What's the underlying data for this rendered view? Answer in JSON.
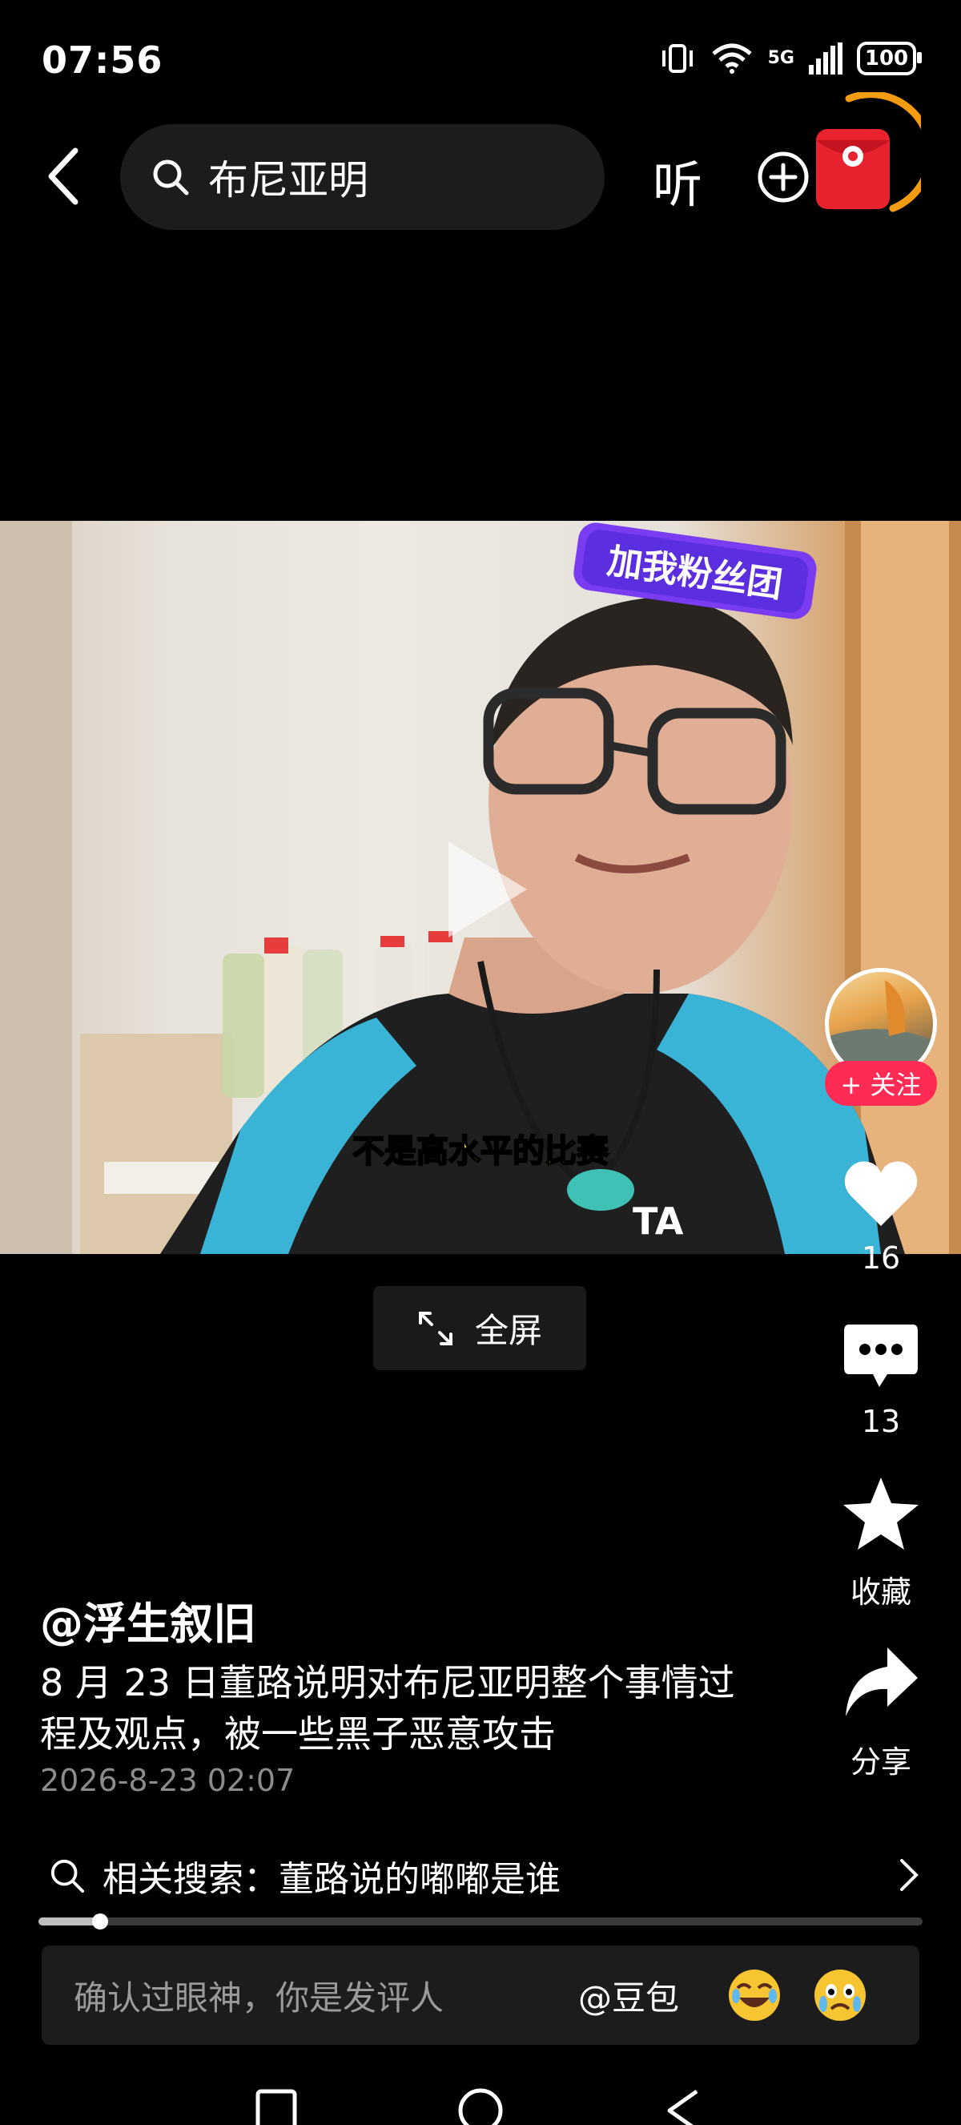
{
  "status": {
    "time": "07:56",
    "network": "5G",
    "battery": "100"
  },
  "header": {
    "search_text": "布尼亚明",
    "listen_label": "听"
  },
  "video": {
    "badge_text": "加我粉丝团",
    "subtitle": "不是高水平的比赛",
    "shirt_text": "TA",
    "fullscreen_label": "全屏"
  },
  "rail": {
    "follow_label": "+ 关注",
    "likes": "16",
    "comments": "13",
    "favorite_label": "收藏",
    "share_label": "分享"
  },
  "post": {
    "author": "@浮生叙旧",
    "description": "8 月 23 日董路说明对布尼亚明整个事情过程及观点，被一些黑子恶意攻击",
    "date": "2026-8-23 02:07"
  },
  "related": {
    "text": "相关搜索：董路说的嘟嘟是谁"
  },
  "progress": {
    "fraction": 0.07
  },
  "comment": {
    "placeholder": "确认过眼神，你是发评人",
    "mention": "@豆包"
  },
  "icons": [
    "back-icon",
    "search-icon",
    "add-icon",
    "red-packet-icon",
    "heart-icon",
    "comment-icon",
    "star-icon",
    "share-icon",
    "chevron-right-icon",
    "expand-icon",
    "play-icon"
  ],
  "colors": {
    "accent": "#fe2c55",
    "ring": "#f39c12",
    "subtitle": "#f4e04d"
  }
}
